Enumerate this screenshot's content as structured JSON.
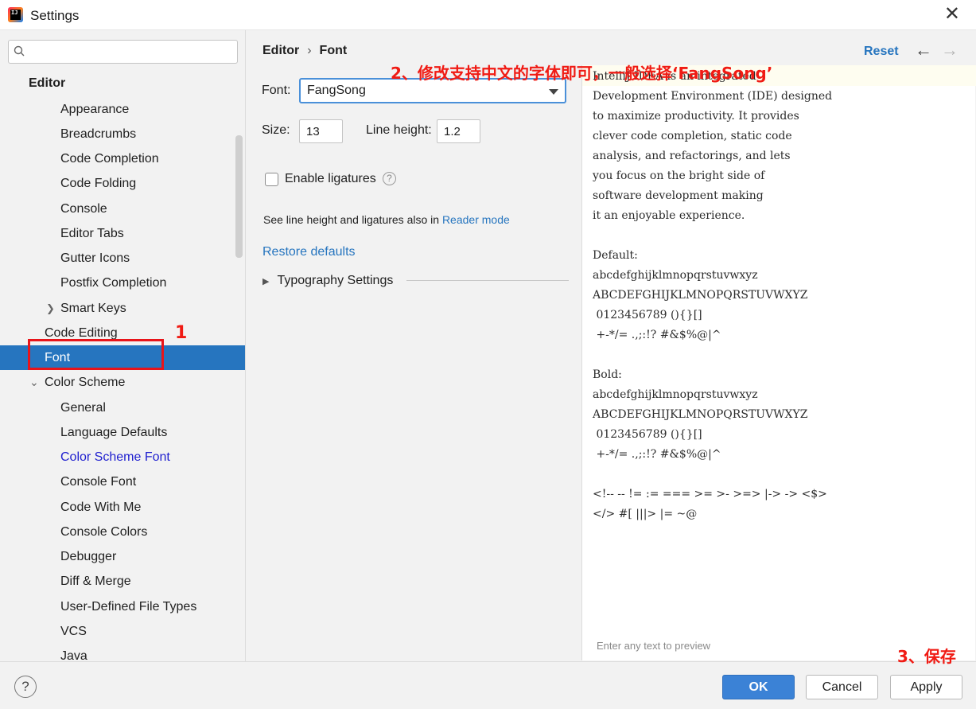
{
  "window": {
    "title": "Settings",
    "close_glyph": "✕"
  },
  "search": {
    "placeholder": "",
    "value": ""
  },
  "sidebar": {
    "items": [
      {
        "label": "Editor"
      },
      {
        "label": "Appearance"
      },
      {
        "label": "Breadcrumbs"
      },
      {
        "label": "Code Completion"
      },
      {
        "label": "Code Folding"
      },
      {
        "label": "Console"
      },
      {
        "label": "Editor Tabs"
      },
      {
        "label": "Gutter Icons"
      },
      {
        "label": "Postfix Completion"
      },
      {
        "label": "Smart Keys"
      },
      {
        "label": "Code Editing"
      },
      {
        "label": "Font",
        "selected": true
      },
      {
        "label": "Color Scheme"
      },
      {
        "label": "General"
      },
      {
        "label": "Language Defaults"
      },
      {
        "label": "Color Scheme Font"
      },
      {
        "label": "Console Font"
      },
      {
        "label": "Code With Me"
      },
      {
        "label": "Console Colors"
      },
      {
        "label": "Debugger"
      },
      {
        "label": "Diff & Merge"
      },
      {
        "label": "User-Defined File Types"
      },
      {
        "label": "VCS"
      },
      {
        "label": "Java"
      }
    ]
  },
  "breadcrumb": {
    "parent": "Editor",
    "separator": "›",
    "current": "Font"
  },
  "toolbar": {
    "reset_label": "Reset",
    "back_glyph": "←",
    "forward_glyph": "→"
  },
  "form": {
    "font_label": "Font:",
    "font_value": "FangSong",
    "size_label": "Size:",
    "size_value": "13",
    "line_height_label": "Line height:",
    "line_height_value": "1.2",
    "ligatures_label": "Enable ligatures",
    "ligatures_checked": false,
    "help_glyph": "?",
    "hint_text": "See line height and ligatures also in ",
    "hint_link": "Reader mode",
    "restore_label": "Restore defaults",
    "typography_label": "Typography Settings"
  },
  "preview": {
    "lines": [
      "IntelliJ IDEA is an integrated",
      "Development Environment (IDE) designed",
      "to maximize productivity. It provides",
      "clever code completion, static code",
      "analysis, and refactorings, and lets",
      "you focus on the bright side of",
      "software development making",
      "it an enjoyable experience.",
      "",
      "Default:",
      "abcdefghijklmnopqrstuvwxyz",
      "ABCDEFGHIJKLMNOPQRSTUVWXYZ",
      " 0123456789 (){}[]",
      " +-*/= .,;:!? #&$%@|^",
      "",
      "Bold:",
      "abcdefghijklmnopqrstuvwxyz",
      "ABCDEFGHIJKLMNOPQRSTUVWXYZ",
      " 0123456789 (){}[]",
      " +-*/= .,;:!? #&$%@|^",
      "",
      "<!-- -- != := === >= >- >=> |-> -> <$>",
      "</> #[ |||> |= ~@"
    ],
    "placeholder": "Enter any text to preview"
  },
  "annotations": {
    "step1": "1",
    "step2": "2、修改支持中文的字体即可，一般选择‘FangSong’",
    "step3": "3、保存",
    "color": "#f01b14"
  },
  "footer": {
    "help_glyph": "?",
    "ok_label": "OK",
    "cancel_label": "Cancel",
    "apply_label": "Apply"
  },
  "colors": {
    "selection": "#2675bf",
    "link": "#2675bf",
    "primary_button": "#3b82d6"
  }
}
